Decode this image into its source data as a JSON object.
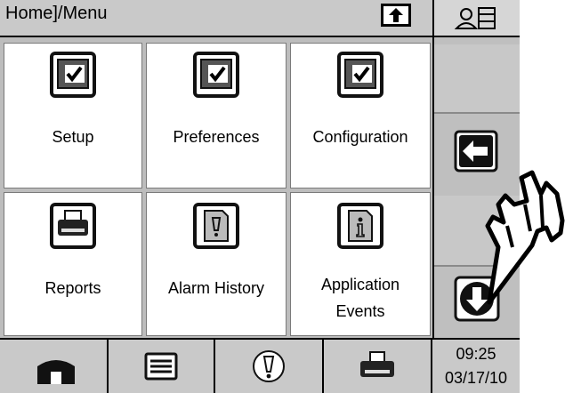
{
  "header": {
    "breadcrumb": "Home]/Menu",
    "up_icon": "up-arrow-icon",
    "user_icon": "user-list-icon"
  },
  "tiles": [
    {
      "label": "Setup",
      "icon": "monitor-check-icon"
    },
    {
      "label": "Preferences",
      "icon": "monitor-check-icon"
    },
    {
      "label": "Configuration",
      "icon": "monitor-check-icon"
    },
    {
      "label": "Reports",
      "icon": "printer-icon"
    },
    {
      "label": "Alarm History",
      "icon": "alarm-document-icon"
    },
    {
      "label_line1": "Application",
      "label_line2": "Events",
      "icon": "info-document-icon"
    }
  ],
  "sidebar": {
    "back_icon": "left-arrow-icon",
    "down_icon": "down-arrow-icon"
  },
  "bottom_bar": {
    "home_icon": "home-icon",
    "list_icon": "list-icon",
    "alarm_icon": "alarm-icon",
    "print_icon": "printer-icon",
    "time": "09:25",
    "date": "03/17/10"
  },
  "overlay": {
    "icon": "pointing-hand-icon"
  },
  "colors": {
    "panel_gray": "#c9c9c9",
    "tile_bg": "#ffffff",
    "icon_dark": "#222222"
  }
}
